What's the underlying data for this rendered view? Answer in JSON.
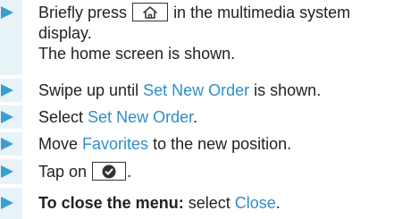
{
  "steps": [
    {
      "lines": [
        {
          "before": "Briefly press",
          "after": "in the multimedia system"
        },
        {
          "text": "display."
        },
        {
          "text": "The home screen is shown."
        }
      ],
      "icon": "home-icon"
    },
    {
      "before": "Swipe up until",
      "link": "Set New Order",
      "after": "is shown."
    },
    {
      "before": "Select",
      "link": "Set New Order",
      "after": "."
    },
    {
      "before": "Move",
      "link": "Favorites",
      "after": "to the new position."
    },
    {
      "before": "Tap on",
      "after": ".",
      "icon": "checkmark-circle-icon"
    },
    {
      "bold": "To close the menu:",
      "before": "select",
      "link": "Close",
      "after": "."
    }
  ],
  "colors": {
    "arrow": "#3a9fd0",
    "stripe": "#e8f3f8",
    "link": "#2d8fc8",
    "text": "#222222"
  }
}
